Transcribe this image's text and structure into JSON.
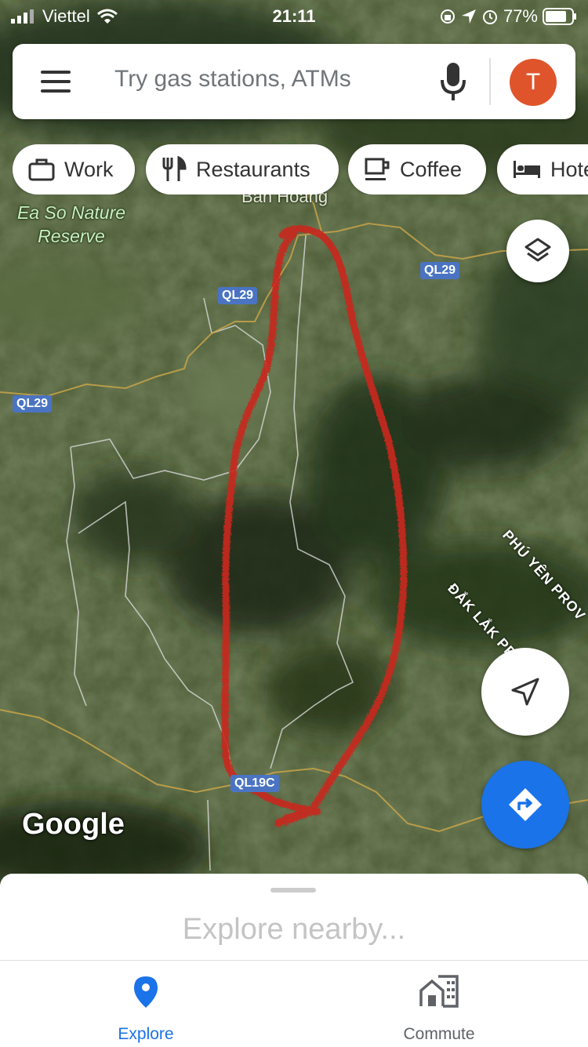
{
  "status": {
    "carrier": "Viettel",
    "time": "21:11",
    "battery": "77%"
  },
  "search": {
    "placeholder": "Try gas stations, ATMs",
    "avatar_letter": "T"
  },
  "chips": [
    {
      "label": "Work",
      "icon": "briefcase-icon"
    },
    {
      "label": "Restaurants",
      "icon": "fork-knife-icon"
    },
    {
      "label": "Coffee",
      "icon": "coffee-cup-icon"
    },
    {
      "label": "Hote",
      "icon": "bed-icon"
    }
  ],
  "map": {
    "place_labels": [
      "Ea So Nature",
      "Reserve"
    ],
    "partial_label": "Bản Hoàng",
    "roads": [
      "QL29",
      "QL29",
      "QL29",
      "QL19C"
    ],
    "provinces": [
      "PHÚ YÊN PROV",
      "ĐẮK LẮK PROVINCE"
    ],
    "logo": "Google"
  },
  "sheet": {
    "title": "Explore nearby..."
  },
  "tabs": [
    {
      "label": "Explore",
      "active": true
    },
    {
      "label": "Commute",
      "active": false
    }
  ],
  "colors": {
    "accent": "#1a73e8",
    "avatar": "#e0542b",
    "drawn_path": "#c8261e"
  }
}
